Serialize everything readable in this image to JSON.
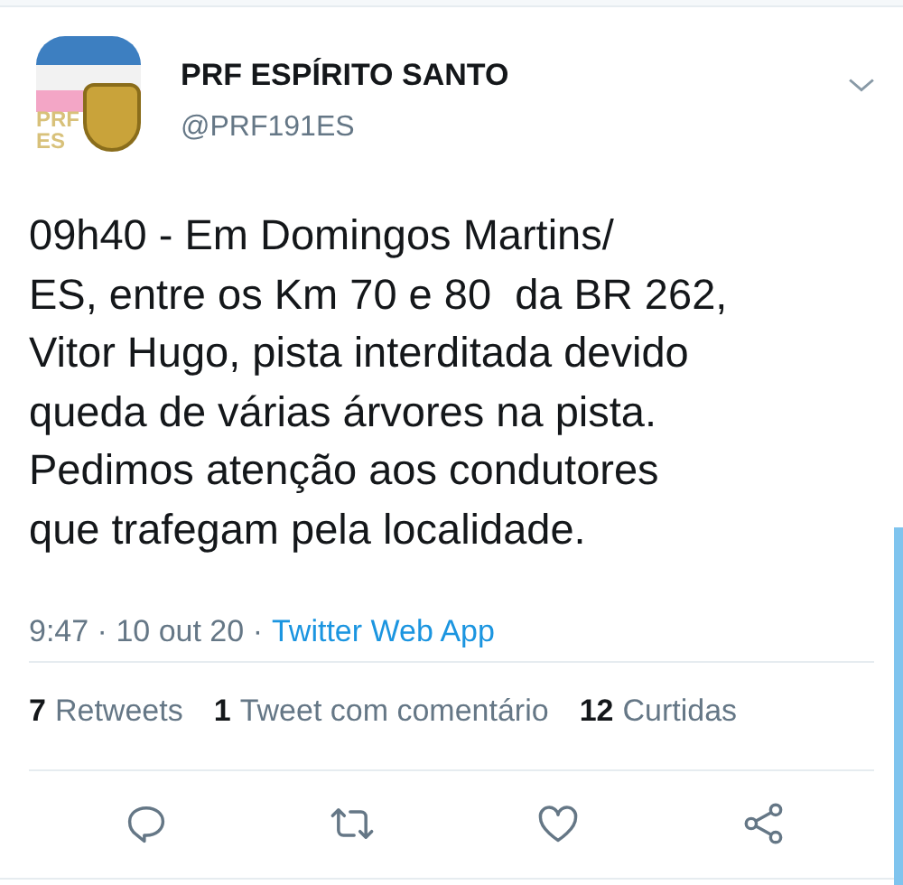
{
  "author": {
    "avatar_text": [
      "PRF",
      "ES"
    ],
    "name": "PRF ESPÍRITO SANTO",
    "handle": "@PRF191ES"
  },
  "tweet_lines": [
    "09h40 - Em Domingos Martins/",
    "ES, entre os Km 70 e 80  da BR 262,",
    "Vitor Hugo, pista interditada devido",
    "queda de várias árvores na pista.",
    "Pedimos atenção aos condutores",
    "que trafegam pela localidade."
  ],
  "meta": {
    "time": "9:47 · 10 out 20 ·",
    "source": "Twitter Web App"
  },
  "stats": [
    {
      "count": "7",
      "label": "Retweets"
    },
    {
      "count": "1",
      "label": "Tweet com comentário"
    },
    {
      "count": "12",
      "label": "Curtidas"
    }
  ],
  "actions": [
    {
      "kind": "reply"
    },
    {
      "kind": "retweet"
    },
    {
      "kind": "like"
    },
    {
      "kind": "share"
    }
  ]
}
